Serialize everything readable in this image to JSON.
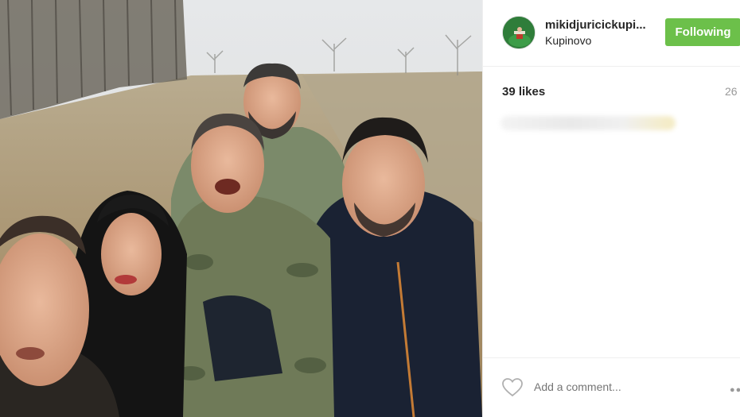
{
  "post": {
    "username": "mikidjuricickupi...",
    "location": "Kupinovo",
    "follow_label": "Following",
    "likes": "39 likes",
    "time_ago": "26"
  },
  "comment": {
    "placeholder": "Add a comment..."
  },
  "icons": {
    "like": "heart-outline-icon",
    "more": "ellipsis-icon"
  },
  "colors": {
    "follow_button": "#6cc04a",
    "text": "#262626",
    "muted": "#999999"
  }
}
